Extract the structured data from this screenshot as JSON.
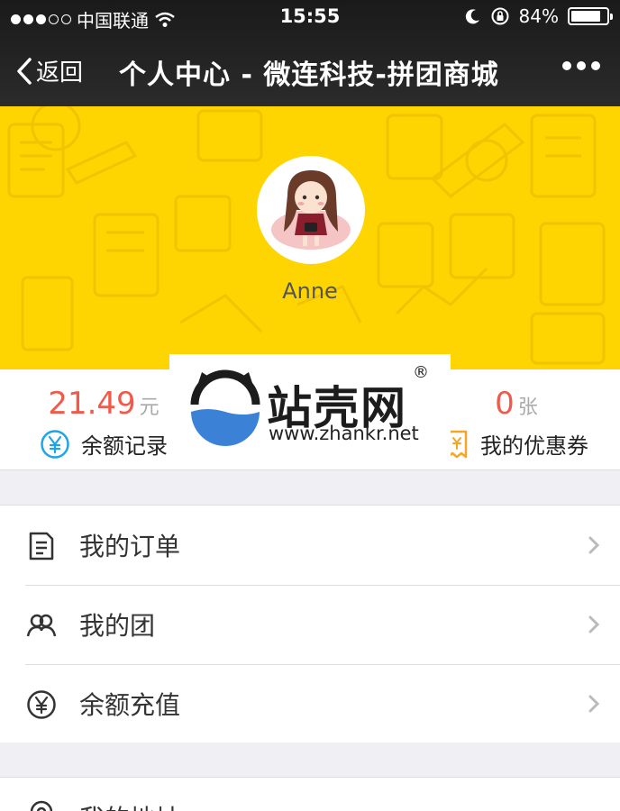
{
  "status_bar": {
    "carrier": "中国联通",
    "time": "15:55",
    "battery": "84%",
    "battery_level": 0.84
  },
  "nav": {
    "back_label": "返回",
    "title": "个人中心 - 微连科技-拼团商城",
    "more_icon": "more-dots-icon"
  },
  "profile": {
    "username": "Anne",
    "background_color": "#fed500"
  },
  "stats": {
    "balance": {
      "value": "21.49",
      "unit": "元",
      "label": "余额记录",
      "icon": "yuan-circle-icon"
    },
    "coupons": {
      "value": "0",
      "unit": "张",
      "label": "我的优惠券",
      "icon": "coupon-icon"
    },
    "value_color": "#f15a4a"
  },
  "watermark": {
    "brand": "站壳网",
    "reg": "®",
    "url": "www.zhankr.net"
  },
  "menu": {
    "items": [
      {
        "label": "我的订单",
        "icon": "order-document-icon"
      },
      {
        "label": "我的团",
        "icon": "group-users-icon"
      },
      {
        "label": "余额充值",
        "icon": "yuan-recharge-icon"
      }
    ],
    "partial_item": {
      "label": "我的地址",
      "icon": "address-pin-icon"
    }
  }
}
